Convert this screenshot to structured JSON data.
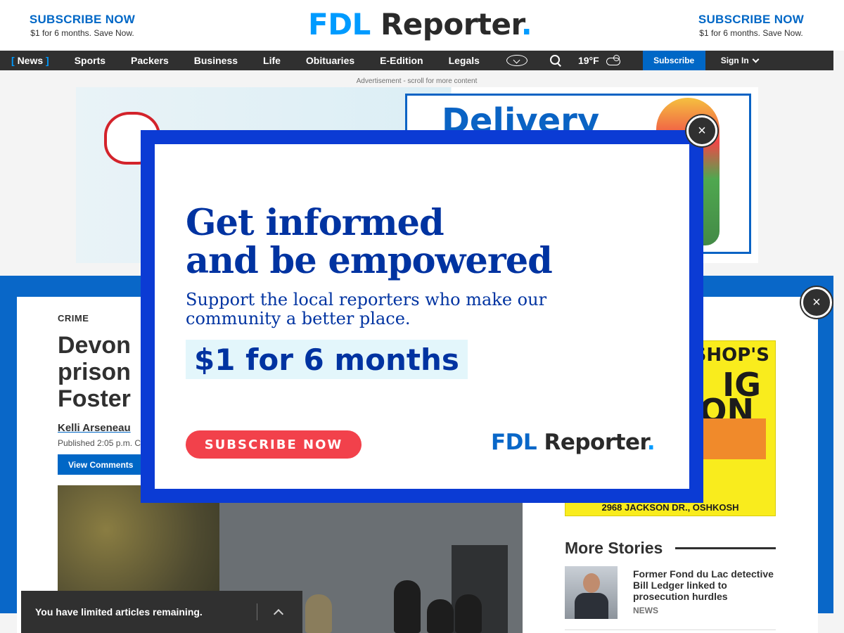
{
  "header": {
    "promo_left": {
      "title": "SUBSCRIBE NOW",
      "subtitle": "$1 for 6 months. Save Now."
    },
    "promo_right": {
      "title": "SUBSCRIBE NOW",
      "subtitle": "$1 for 6 months. Save Now."
    },
    "brand": {
      "part1": "FDL",
      "part2": " Reporter",
      "dot": "."
    }
  },
  "nav": {
    "items": [
      {
        "label": "News",
        "active": true
      },
      {
        "label": "Sports"
      },
      {
        "label": "Packers"
      },
      {
        "label": "Business"
      },
      {
        "label": "Life"
      },
      {
        "label": "Obituaries"
      },
      {
        "label": "E-Edition"
      },
      {
        "label": "Legals"
      }
    ],
    "active_open": "[",
    "active_close": "]",
    "globe_icon": "globe-chevron-icon",
    "search_icon": "search-icon",
    "weather": {
      "temp": "19°F",
      "icon": "partly-cloudy-icon"
    },
    "subscribe_label": "Subscribe",
    "signin_label": "Sign In"
  },
  "ad": {
    "label": "Advertisement - scroll for more content",
    "top_text": "Delivery",
    "sidebar_line1": "SHOP'S",
    "sidebar_line2": "IG",
    "sidebar_line3": "ON",
    "sidebar_address": "2968 JACKSON DR., OSHKOSH"
  },
  "article": {
    "section": "CRIME",
    "headline_lines": [
      "Devon",
      "prison",
      "Foster"
    ],
    "byline": "Kelli Arseneau",
    "published": "Published 2:05 p.m. C",
    "view_comments": "View Comments"
  },
  "more_stories": {
    "title": "More Stories",
    "items": [
      {
        "headline": "Former Fond du Lac detective Bill Ledger linked to prosecution hurdles",
        "tag": "NEWS"
      }
    ]
  },
  "limited_bar": {
    "text": "You have limited articles remaining."
  },
  "modal": {
    "title_line1": "Get informed",
    "title_line2": "and be empowered",
    "subtitle": "Support the local reporters who make our community a better place.",
    "price": "$1 for 6 months",
    "cta": "SUBSCRIBE NOW",
    "logo": {
      "part1": "FDL",
      "part2": " Reporter",
      "dot": "."
    },
    "close_symbol": "×"
  },
  "colors": {
    "accent_blue": "#0067c6",
    "modal_border": "#0b3bd4",
    "modal_text": "#0033a1",
    "cta_red": "#f2414b",
    "nav_bg": "#303030"
  }
}
